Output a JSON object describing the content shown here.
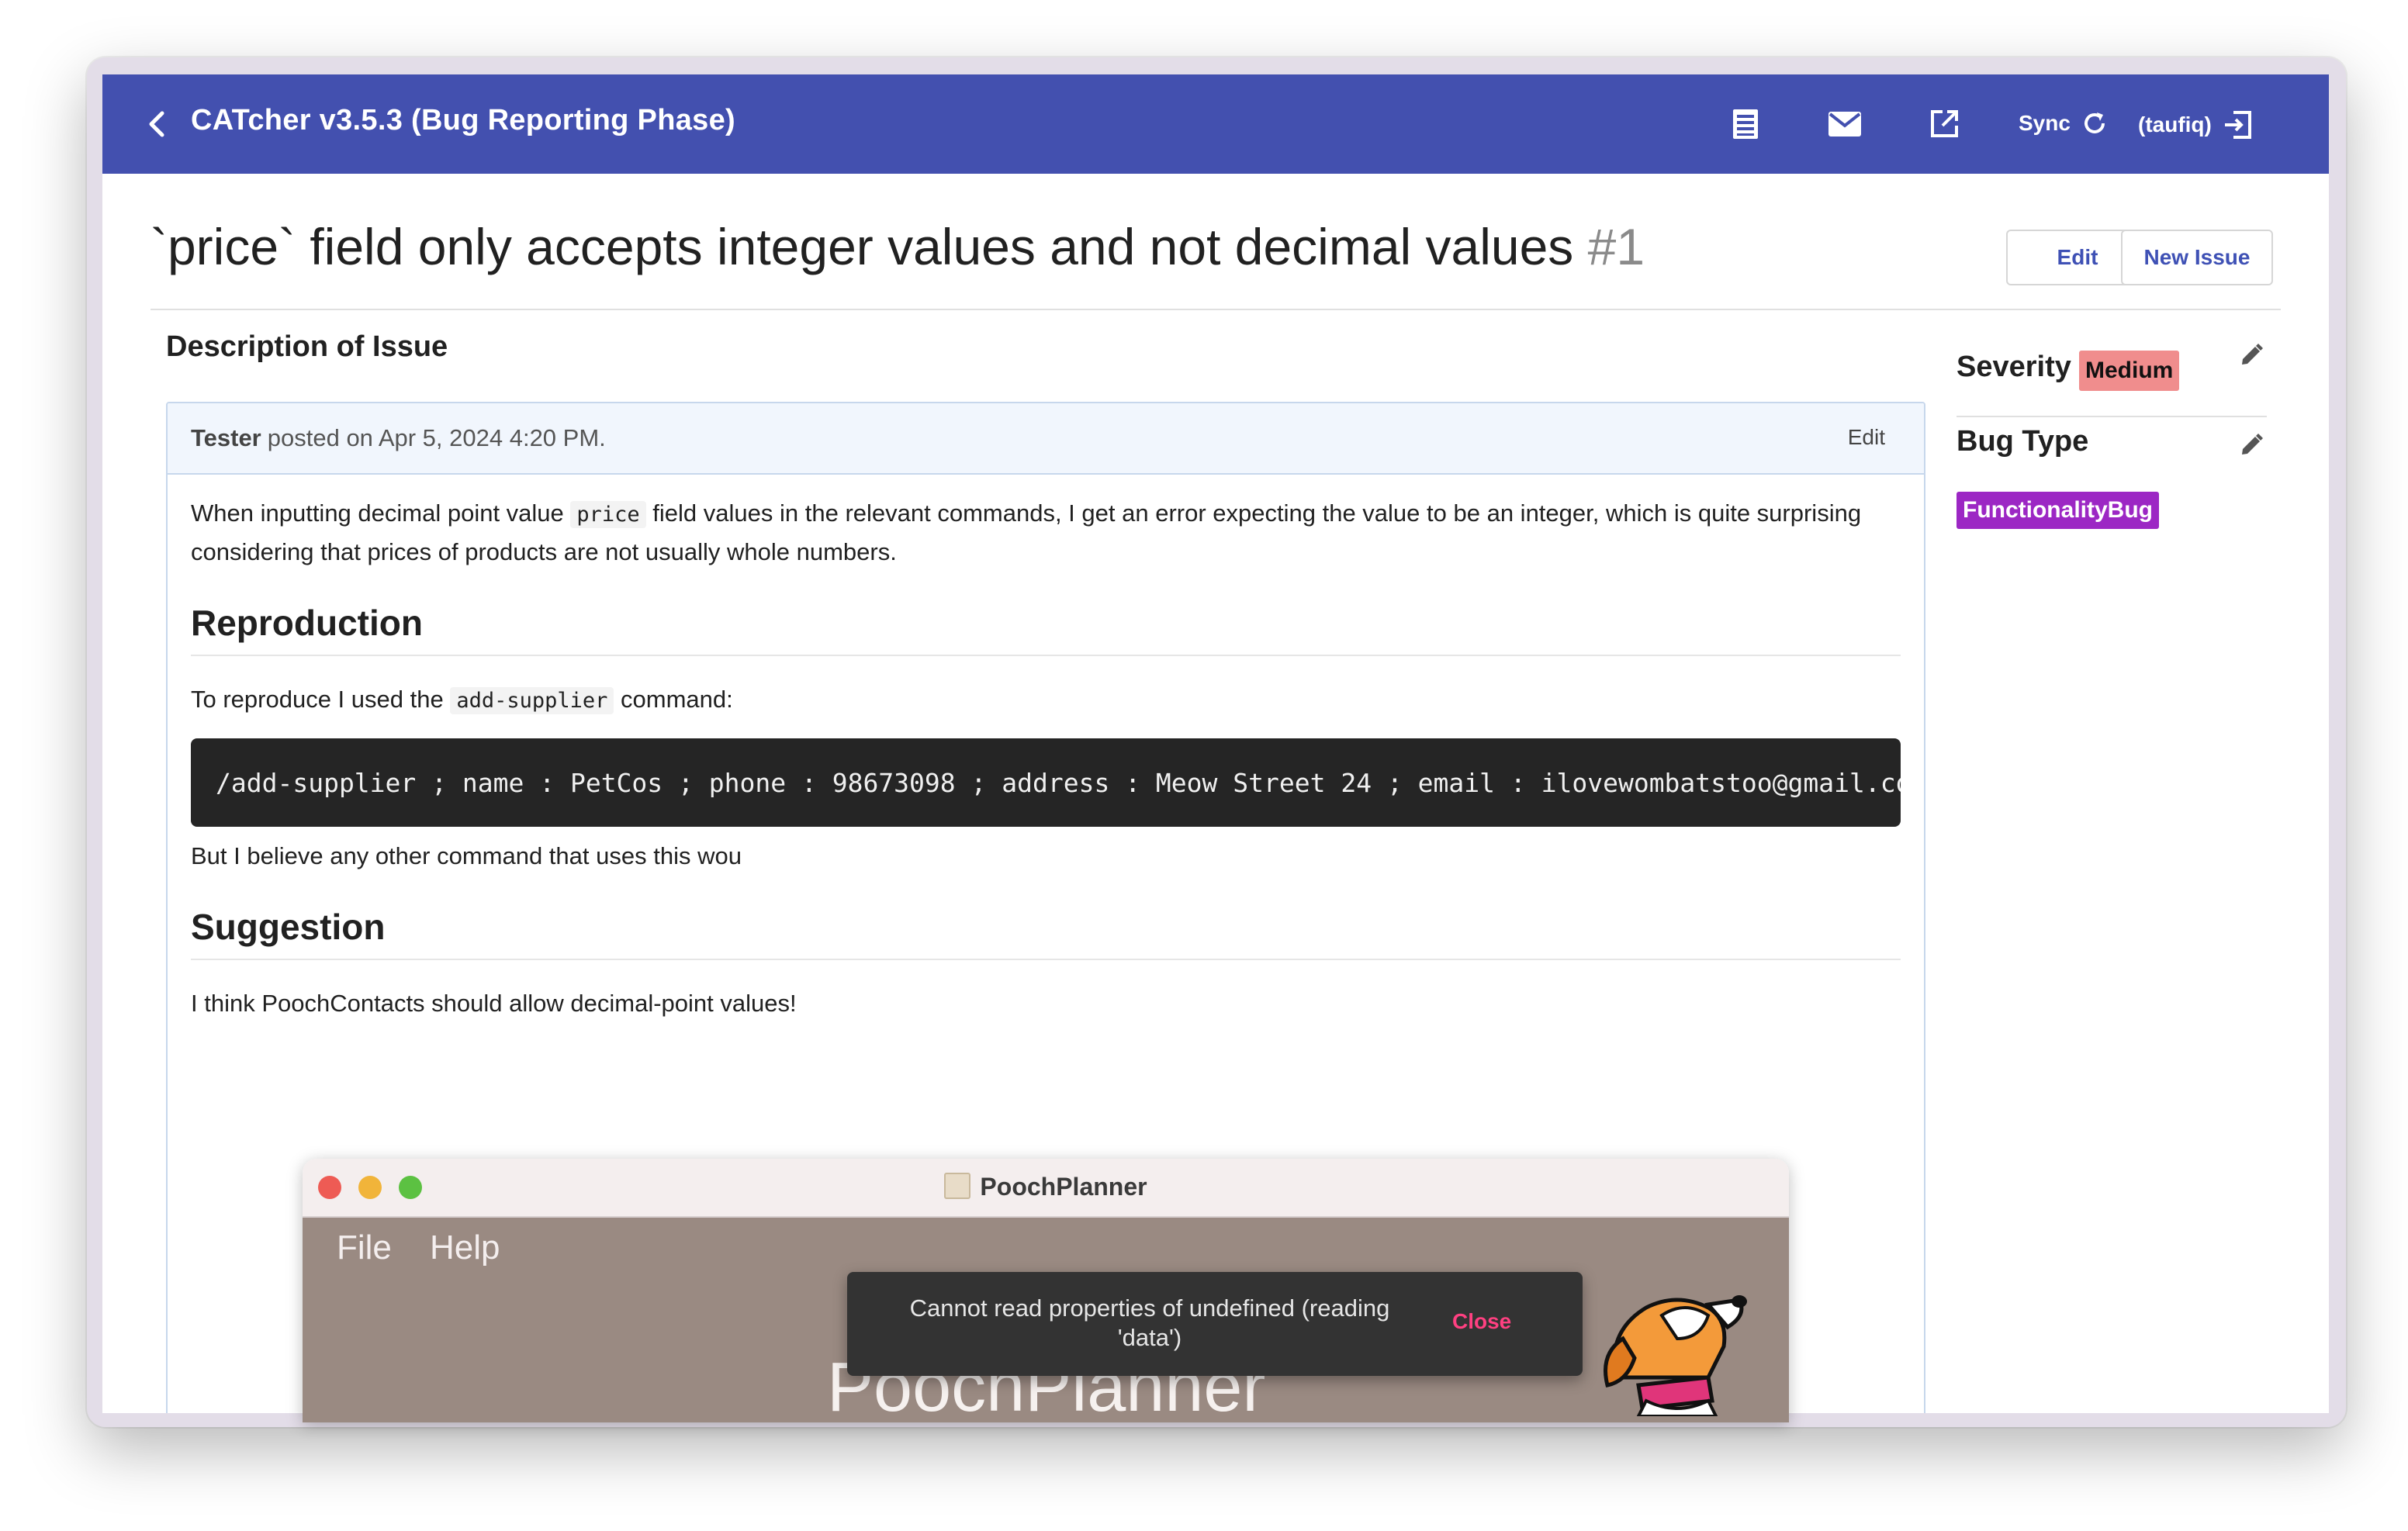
{
  "toolbar": {
    "title": "CATcher v3.5.3  (Bug Reporting Phase)",
    "sync_label": "Sync",
    "user_label": "(taufiq)",
    "bg_color": "#4350af",
    "icons": [
      "back-arrow-icon",
      "list-icon",
      "mail-icon",
      "open-external-icon",
      "refresh-icon",
      "logout-icon"
    ]
  },
  "issue": {
    "title": "`price` field only accepts integer values and not decimal values",
    "number": "#1",
    "edit_label": "Edit",
    "new_issue_label": "New Issue"
  },
  "description": {
    "section_title": "Description of Issue",
    "author": "Tester",
    "posted_text": "posted on Apr 5, 2024 4:20 PM.",
    "edit_label": "Edit",
    "para1_a": "When inputting decimal point value ",
    "para1_code": "price",
    "para1_b": " field values in the relevant commands, I get an error expecting the value to be an integer, which is quite surprising considering that prices of products are not usually whole numbers.",
    "h_reproduction": "Reproduction",
    "repro_a": "To reproduce I used the ",
    "repro_code": "add-supplier",
    "repro_b": " command:",
    "code_block": "/add-supplier ; name : PetCos ; phone : 98673098 ; address : Meow Street 24 ; email : ilovewombatstoo@gmail.com",
    "after_code": "But I believe any other command that uses this wou",
    "h_suggestion": "Suggestion",
    "suggestion_text": "I think PoochContacts should allow decimal-point values!"
  },
  "sidebar": {
    "severity_label": "Severity",
    "severity_value": "Medium",
    "severity_color": "#f08d8d",
    "bug_type_label": "Bug Type",
    "bug_type_value": "FunctionalityBug",
    "bug_type_color": "#9c27c4"
  },
  "embedded_screenshot": {
    "window_title": "PoochPlanner",
    "menu_file": "File",
    "menu_help": "Help",
    "big_title": "PoochPlanner"
  },
  "snackbar": {
    "message": "Cannot read properties of undefined (reading 'data')",
    "close_label": "Close"
  }
}
